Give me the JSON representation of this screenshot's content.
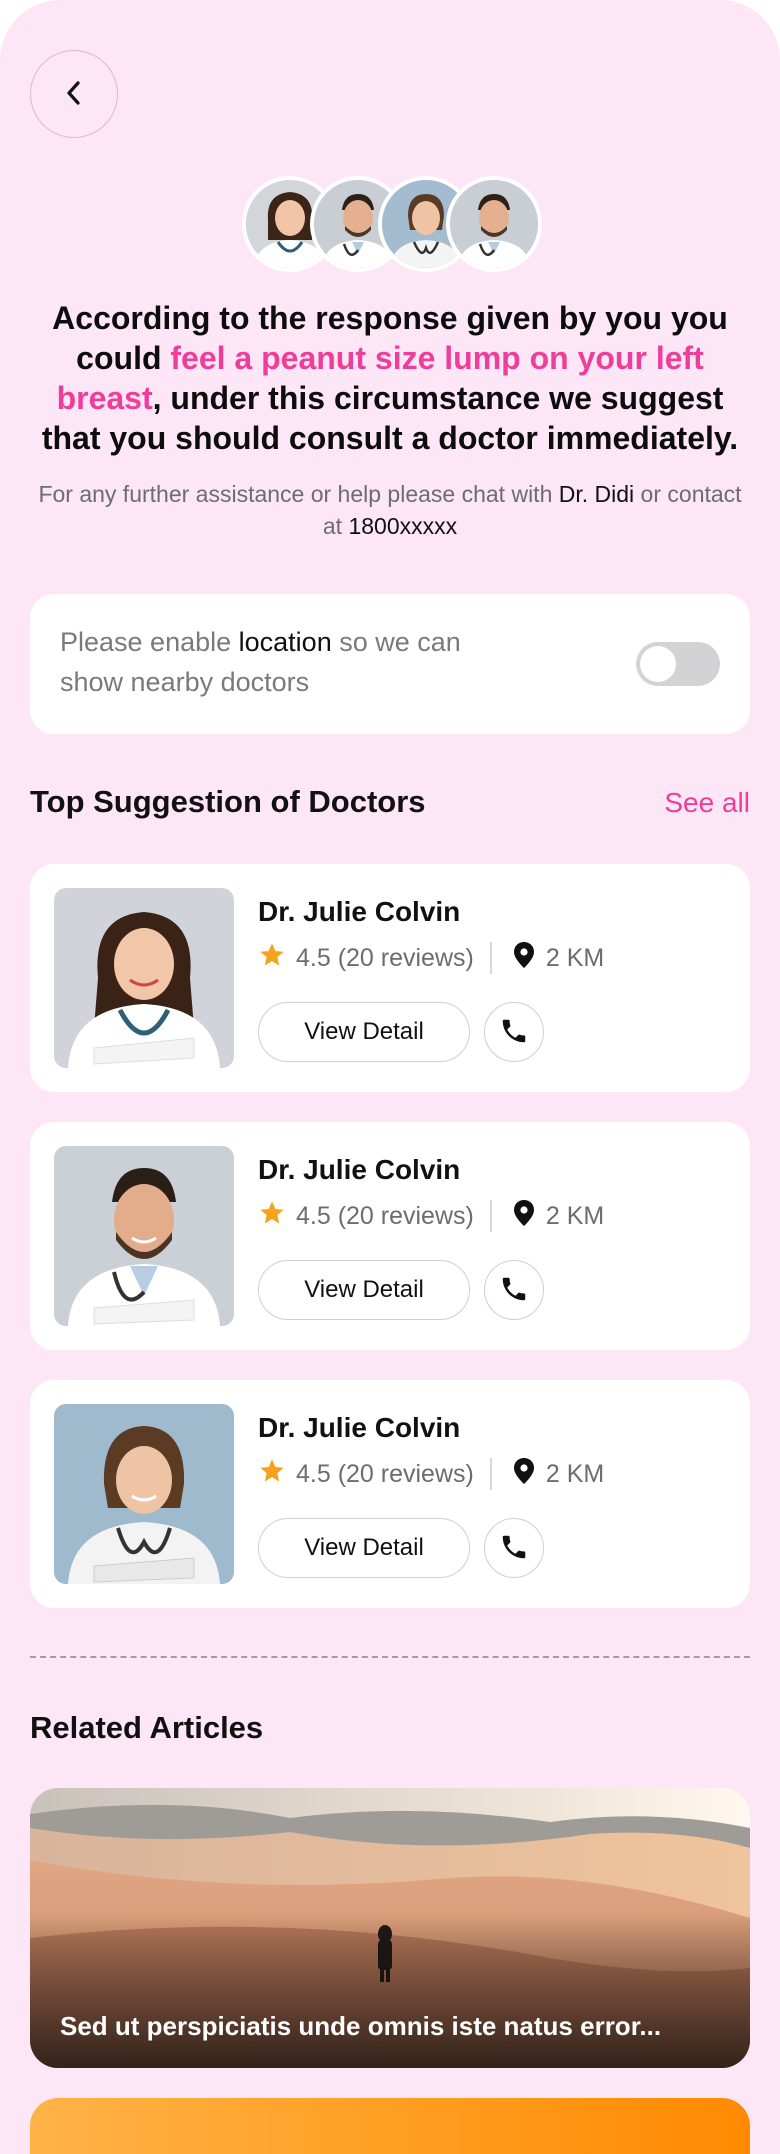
{
  "header": {
    "back_icon": "chevron-left-icon"
  },
  "doctor_avatars": [
    {
      "name": "female-doctor-1",
      "bg": "#cfd3d8"
    },
    {
      "name": "male-doctor-1",
      "bg": "#c6cbd1"
    },
    {
      "name": "female-doctor-2",
      "bg": "#9fb8cc"
    },
    {
      "name": "male-doctor-2",
      "bg": "#c6cbd1"
    }
  ],
  "headline": {
    "part1": "According to the response given by you you could ",
    "highlight": "feel a peanut size lump on your left breast",
    "part2": ", under this circumstance we suggest that you should consult a doctor immediately."
  },
  "assistance": {
    "prefix": "For any further assistance or help please chat with ",
    "doctor": "Dr. Didi",
    "middle": " or contact at ",
    "phone": "1800xxxxx"
  },
  "location_prompt": {
    "prefix": "Please enable ",
    "keyword": "location",
    "suffix": " so we can show nearby doctors",
    "toggle_on": false
  },
  "suggestions": {
    "title": "Top Suggestion of Doctors",
    "see_all": "See all",
    "doctors": [
      {
        "name": "Dr. Julie Colvin",
        "rating": "4.5 (20 reviews)",
        "distance": "2 KM",
        "view_detail": "View Detail"
      },
      {
        "name": "Dr. Julie Colvin",
        "rating": "4.5 (20 reviews)",
        "distance": "2 KM",
        "view_detail": "View Detail"
      },
      {
        "name": "Dr. Julie Colvin",
        "rating": "4.5 (20 reviews)",
        "distance": "2 KM",
        "view_detail": "View Detail"
      }
    ]
  },
  "articles": {
    "title": "Related Articles",
    "items": [
      {
        "title": "Sed ut perspiciatis unde omnis iste natus error..."
      }
    ]
  },
  "colors": {
    "accent": "#ef3e9a",
    "background": "#fde6f5",
    "star": "#f7a21b",
    "card": "#ffffff"
  }
}
